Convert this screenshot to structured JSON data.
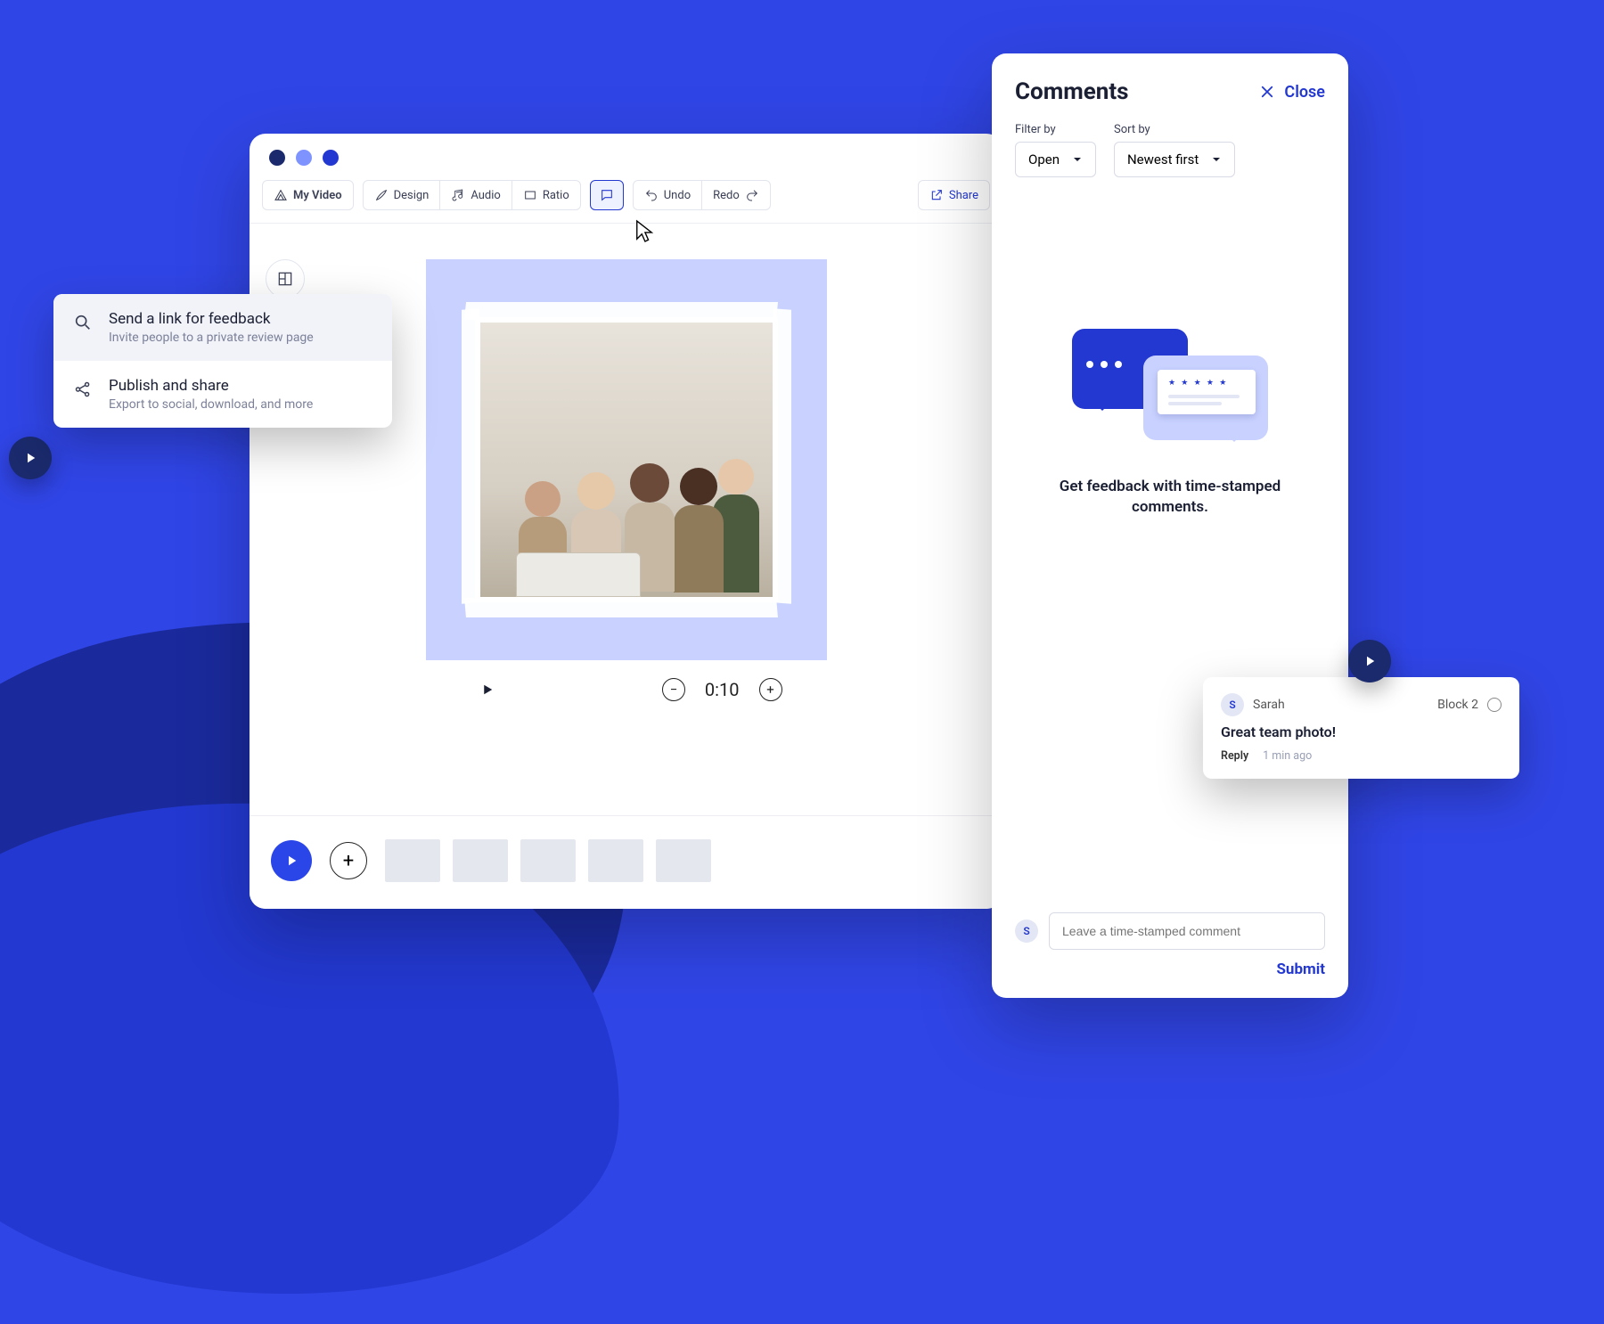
{
  "editor": {
    "projectName": "My Video",
    "toolbar": {
      "design": "Design",
      "audio": "Audio",
      "ratio": "Ratio",
      "undo": "Undo",
      "redo": "Redo",
      "share": "Share"
    },
    "playback": {
      "time": "0:10"
    }
  },
  "shareMenu": {
    "feedback": {
      "title": "Send a link for feedback",
      "sub": "Invite people to a private review page"
    },
    "publish": {
      "title": "Publish and share",
      "sub": "Export to social, download, and more"
    }
  },
  "comments": {
    "title": "Comments",
    "close": "Close",
    "filterLabel": "Filter by",
    "filterValue": "Open",
    "sortLabel": "Sort by",
    "sortValue": "Newest first",
    "emptyText": "Get feedback with time-stamped comments.",
    "inputPlaceholder": "Leave a time-stamped comment",
    "submit": "Submit",
    "avatarInitial": "S"
  },
  "commentCard": {
    "avatarInitial": "S",
    "author": "Sarah",
    "block": "Block 2",
    "text": "Great team photo!",
    "reply": "Reply",
    "time": "1 min ago"
  }
}
